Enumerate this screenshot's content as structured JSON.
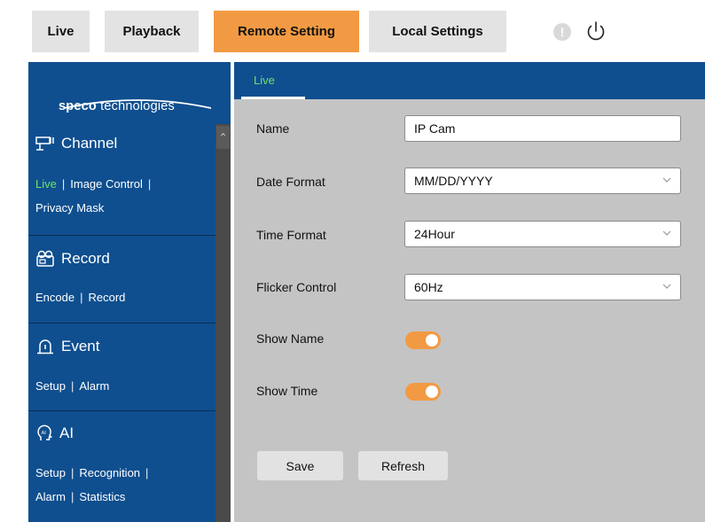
{
  "top_tabs": [
    {
      "label": "Live"
    },
    {
      "label": "Playback"
    },
    {
      "label": "Remote Setting",
      "active": true
    },
    {
      "label": "Local Settings"
    }
  ],
  "header_icons": {
    "alert": "!",
    "alert_icon": "alert-circle-icon",
    "power_icon": "power-icon"
  },
  "sidebar": {
    "logo": {
      "bold": "speco",
      "rest": " technologies"
    },
    "sections": [
      {
        "title": "Channel",
        "icon": "monitor-camera-icon",
        "links": [
          {
            "label": "Live",
            "current": true
          },
          {
            "label": "Image Control"
          },
          {
            "label": "Privacy Mask"
          }
        ]
      },
      {
        "title": "Record",
        "icon": "record-icon",
        "links": [
          {
            "label": "Encode"
          },
          {
            "label": "Record"
          }
        ]
      },
      {
        "title": "Event",
        "icon": "event-alarm-icon",
        "links": [
          {
            "label": "Setup"
          },
          {
            "label": "Alarm"
          }
        ]
      },
      {
        "title": "AI",
        "icon": "ai-head-icon",
        "links": [
          {
            "label": "Setup"
          },
          {
            "label": "Recognition"
          },
          {
            "label": "Alarm"
          },
          {
            "label": "Statistics"
          }
        ]
      }
    ]
  },
  "content": {
    "tab": "Live",
    "fields": {
      "name": {
        "label": "Name",
        "value": "IP Cam"
      },
      "date_format": {
        "label": "Date Format",
        "value": "MM/DD/YYYY"
      },
      "time_format": {
        "label": "Time Format",
        "value": "24Hour"
      },
      "flicker": {
        "label": "Flicker Control",
        "value": "60Hz"
      },
      "show_name": {
        "label": "Show Name",
        "on": true
      },
      "show_time": {
        "label": "Show Time",
        "on": true
      }
    },
    "buttons": {
      "save": "Save",
      "refresh": "Refresh"
    }
  },
  "colors": {
    "accent": "#f29a43",
    "sidebar": "#0f4f8f",
    "active_link": "#6fe06f",
    "panel": "#c4c4c4"
  }
}
